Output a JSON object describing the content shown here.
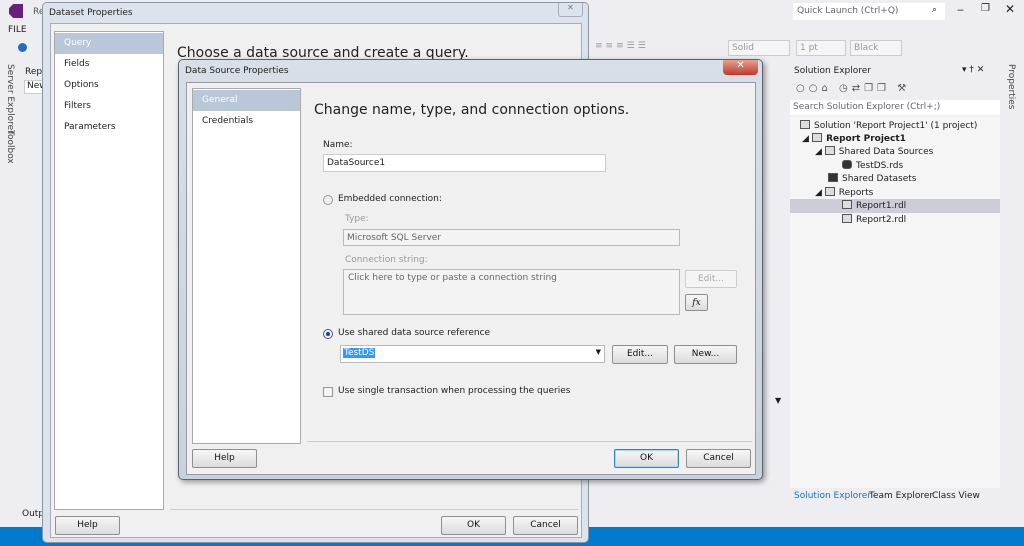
{
  "ide": {
    "title_partial": "Re",
    "menu_file": "FILE",
    "quick_launch_placeholder": "Quick Launch (Ctrl+Q)",
    "left_tabs": [
      "Server Explorer",
      "Toolbox"
    ],
    "left_panel": {
      "label": "Rep",
      "dropdown": "New"
    },
    "output_label": "Outp",
    "toolbar": {
      "line_style": "Solid",
      "line_width": "1 pt",
      "line_color": "Black"
    },
    "right_tab": "Properties",
    "accent": "#007acc"
  },
  "solution_explorer": {
    "title": "Solution Explorer",
    "search_placeholder": "Search Solution Explorer (Ctrl+;)",
    "tree": [
      {
        "label": "Solution 'Report Project1' (1 project)",
        "level": 0
      },
      {
        "label": "Report Project1",
        "level": 1,
        "bold": true
      },
      {
        "label": "Shared Data Sources",
        "level": 2
      },
      {
        "label": "TestDS.rds",
        "level": 3
      },
      {
        "label": "Shared Datasets",
        "level": 2
      },
      {
        "label": "Reports",
        "level": 2
      },
      {
        "label": "Report1.rdl",
        "level": 3,
        "selected": true
      },
      {
        "label": "Report2.rdl",
        "level": 3
      }
    ],
    "tabs": [
      "Solution Explorer",
      "Team Explorer",
      "Class View"
    ]
  },
  "dataset_dialog": {
    "title": "Dataset Properties",
    "nav": [
      "Query",
      "Fields",
      "Options",
      "Filters",
      "Parameters"
    ],
    "heading": "Choose a data source and create a query.",
    "help": "Help",
    "ok": "OK",
    "cancel": "Cancel"
  },
  "datasource_dialog": {
    "title": "Data Source Properties",
    "nav": [
      "General",
      "Credentials"
    ],
    "heading": "Change name, type, and connection options.",
    "name_label": "Name:",
    "name_value": "DataSource1",
    "embedded_label": "Embedded connection:",
    "type_label": "Type:",
    "type_value": "Microsoft SQL Server",
    "conn_label": "Connection string:",
    "conn_placeholder": "Click here to type or paste a connection string",
    "edit_conn": "Edit...",
    "fx": "fx",
    "shared_label": "Use shared data source reference",
    "shared_value": "TestDS",
    "edit": "Edit...",
    "new": "New...",
    "single_tx_label": "Use single transaction when processing the queries",
    "help": "Help",
    "ok": "OK",
    "cancel": "Cancel"
  }
}
